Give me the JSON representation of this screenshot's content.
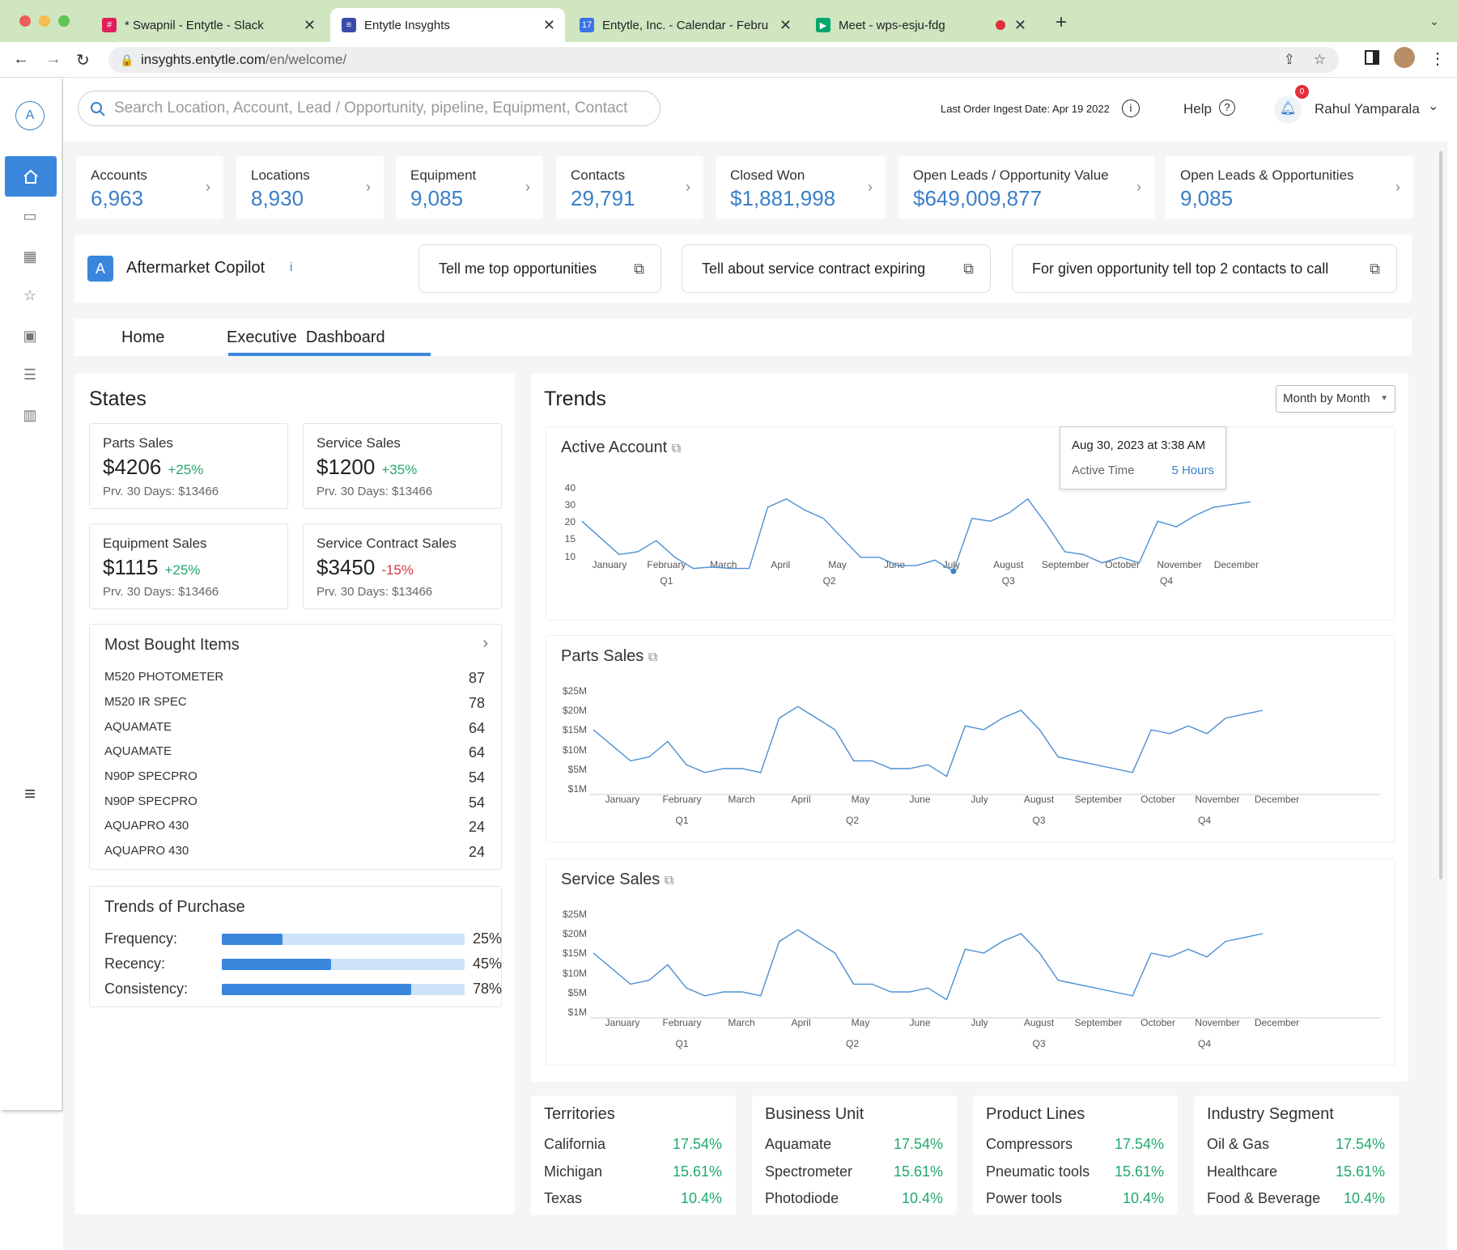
{
  "browser": {
    "tabs": [
      {
        "title": "* Swapnil - Entytle - Slack"
      },
      {
        "title": "Entytle Insyghts"
      },
      {
        "title": "Entytle, Inc. - Calendar - Febru"
      },
      {
        "title": "Meet - wps-esju-fdg"
      }
    ],
    "url_host": "insyghts.entytle.com",
    "url_path": "/en/welcome/"
  },
  "header": {
    "search_placeholder": "Search Location, Account, Lead / Opportunity, pipeline, Equipment, Contact",
    "ingest": "Last Order Ingest Date: Apr 19 2022",
    "help": "Help",
    "notif_count": "0",
    "user": "Rahul Yamparala",
    "logo": "A"
  },
  "kpis": [
    {
      "label": "Accounts",
      "value": "6,963"
    },
    {
      "label": "Locations",
      "value": "8,930"
    },
    {
      "label": "Equipment",
      "value": "9,085"
    },
    {
      "label": "Contacts",
      "value": "29,791"
    },
    {
      "label": "Closed Won",
      "value": "$1,881,998"
    },
    {
      "label": "Open Leads / Opportunity Value",
      "value": "$649,009,877"
    },
    {
      "label": "Open Leads & Opportunities",
      "value": "9,085"
    }
  ],
  "copilot": {
    "title": "Aftermarket Copilot",
    "info": "i",
    "q1": "Tell me top opportunities",
    "q2": "Tell about service contract expiring",
    "q3": "For given opportunity tell top 2 contacts to call"
  },
  "tabs": {
    "home": "Home",
    "exec": "Executive  Dashboard"
  },
  "states": {
    "title": "States",
    "cards": [
      {
        "label": "Parts Sales",
        "value": "$4206",
        "change": "+25%",
        "prev": "Prv. 30 Days: $13466"
      },
      {
        "label": "Service Sales",
        "value": "$1200",
        "change": "+35%",
        "prev": "Prv. 30 Days: $13466"
      },
      {
        "label": "Equipment Sales",
        "value": "$1115",
        "change": "+25%",
        "prev": "Prv. 30 Days: $13466"
      },
      {
        "label": "Service Contract Sales",
        "value": "$3450",
        "change": "-15%",
        "prev": "Prv. 30 Days: $13466"
      }
    ]
  },
  "most_bought": {
    "title": "Most Bought Items",
    "items": [
      {
        "name": "M520 PHOTOMETER",
        "qty": "87"
      },
      {
        "name": "M520 IR SPEC",
        "qty": "78"
      },
      {
        "name": "AQUAMATE",
        "qty": "64"
      },
      {
        "name": "AQUAMATE",
        "qty": "64"
      },
      {
        "name": "N90P SPECPRO",
        "qty": "54"
      },
      {
        "name": "N90P SPECPRO",
        "qty": "54"
      },
      {
        "name": "AQUAPRO 430",
        "qty": "24"
      },
      {
        "name": "AQUAPRO 430",
        "qty": "24"
      }
    ]
  },
  "purchase": {
    "title": "Trends of Purchase",
    "rows": [
      {
        "label": "Frequency:",
        "pct": "25%",
        "value": 25
      },
      {
        "label": "Recency:",
        "pct": "45%",
        "value": 45
      },
      {
        "label": "Consistency:",
        "pct": "78%",
        "value": 78
      }
    ]
  },
  "trends": {
    "title": "Trends",
    "dropdown": "Month by Month",
    "tooltip": {
      "date": "Aug 30, 2023 at 3:38 AM",
      "label": "Active Time",
      "value": "5 Hours"
    }
  },
  "chart_data": [
    {
      "type": "line",
      "title": "Active Account",
      "categories": [
        "January",
        "February",
        "March",
        "April",
        "May",
        "June",
        "July",
        "August",
        "September",
        "October",
        "November",
        "December"
      ],
      "quarters": [
        "Q1",
        "Q2",
        "Q3",
        "Q4"
      ],
      "yticks": [
        "40",
        "30",
        "20",
        "15",
        "10"
      ],
      "values": [
        28,
        22,
        16,
        17,
        21,
        15,
        11,
        11.5,
        11,
        11,
        33,
        36,
        32,
        29,
        22,
        15,
        15,
        12,
        12,
        14,
        10,
        29,
        28,
        31,
        36,
        27,
        17,
        16,
        13,
        15,
        13,
        28,
        26,
        30,
        33,
        34,
        35
      ]
    },
    {
      "type": "line",
      "title": "Parts Sales",
      "categories": [
        "January",
        "February",
        "March",
        "April",
        "May",
        "June",
        "July",
        "August",
        "September",
        "October",
        "November",
        "December"
      ],
      "quarters": [
        "Q1",
        "Q2",
        "Q3",
        "Q4"
      ],
      "yticks": [
        "$25M",
        "$20M",
        "$15M",
        "$10M",
        "$5M",
        "$1M"
      ],
      "values": [
        15,
        11,
        7,
        8,
        12,
        6,
        4,
        5,
        5,
        4,
        18,
        21,
        18,
        15,
        7,
        7,
        5,
        5,
        6,
        3,
        16,
        15,
        18,
        20,
        15,
        8,
        7,
        6,
        5,
        4,
        15,
        14,
        16,
        14,
        18,
        19,
        20
      ]
    },
    {
      "type": "line",
      "title": "Service Sales",
      "categories": [
        "January",
        "February",
        "March",
        "April",
        "May",
        "June",
        "July",
        "August",
        "September",
        "October",
        "November",
        "December"
      ],
      "quarters": [
        "Q1",
        "Q2",
        "Q3",
        "Q4"
      ],
      "yticks": [
        "$25M",
        "$20M",
        "$15M",
        "$10M",
        "$5M",
        "$1M"
      ],
      "values": [
        15,
        11,
        7,
        8,
        12,
        6,
        4,
        5,
        5,
        4,
        18,
        21,
        18,
        15,
        7,
        7,
        5,
        5,
        6,
        3,
        16,
        15,
        18,
        20,
        15,
        8,
        7,
        6,
        5,
        4,
        15,
        14,
        16,
        14,
        18,
        19,
        20
      ]
    }
  ],
  "segments": [
    {
      "title": "Territories",
      "rows": [
        [
          "California",
          "17.54%"
        ],
        [
          "Michigan",
          "15.61%"
        ],
        [
          "Texas",
          "10.4%"
        ]
      ]
    },
    {
      "title": "Business Unit",
      "rows": [
        [
          "Aquamate",
          "17.54%"
        ],
        [
          "Spectrometer",
          "15.61%"
        ],
        [
          "Photodiode",
          "10.4%"
        ]
      ]
    },
    {
      "title": "Product Lines",
      "rows": [
        [
          "Compressors",
          "17.54%"
        ],
        [
          "Pneumatic tools",
          "15.61%"
        ],
        [
          "Power tools",
          "10.4%"
        ]
      ]
    },
    {
      "title": "Industry Segment",
      "rows": [
        [
          "Oil & Gas",
          "17.54%"
        ],
        [
          "Healthcare",
          "15.61%"
        ],
        [
          "Food & Beverage",
          "10.4%"
        ]
      ]
    }
  ],
  "colors": {
    "accent": "#3a7fc8",
    "positive": "#22a86b",
    "negative": "#d9363e",
    "line": "#4a8fd4"
  }
}
